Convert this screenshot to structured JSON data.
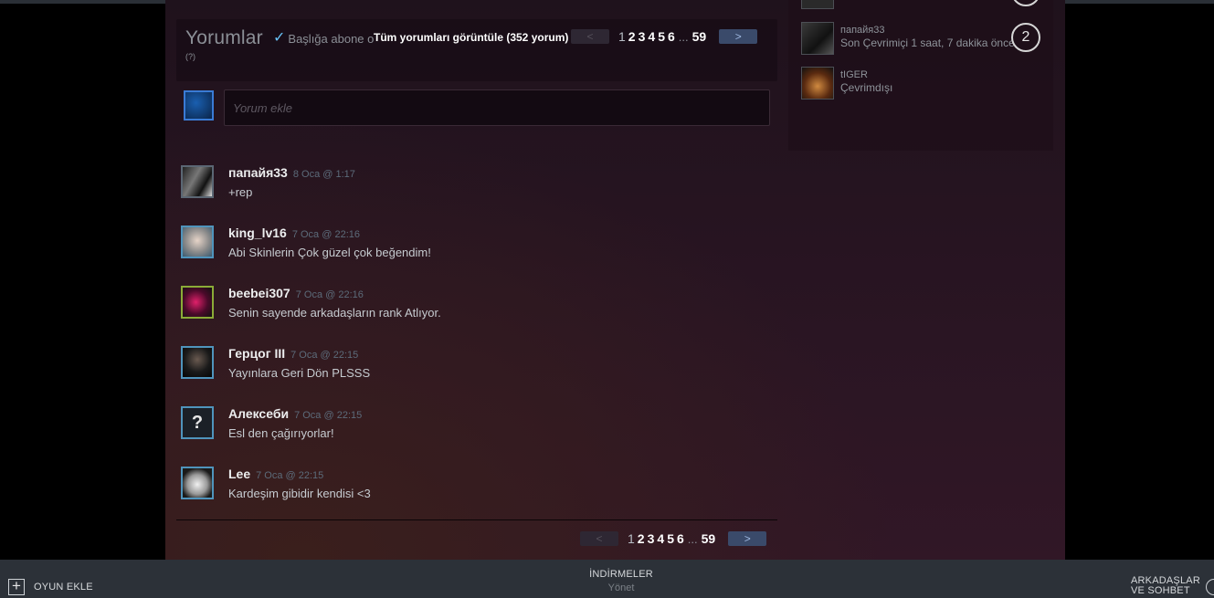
{
  "comments_section": {
    "title": "Yorumlar",
    "help": "(?)",
    "subscribe_label": "Başlığa abone ol",
    "view_all": "Tüm yorumları görüntüle (352 yorum)",
    "add_placeholder": "Yorum ekle",
    "pager": {
      "prev": "<",
      "next": ">",
      "pages": [
        "1",
        "2",
        "3",
        "4",
        "5",
        "6"
      ],
      "ellipsis": "...",
      "last": "59",
      "current": "1"
    },
    "comments": [
      {
        "author": "папайя33",
        "date": "8 Oca @ 1:17",
        "text": "+rep"
      },
      {
        "author": "king_lv16",
        "date": "7 Oca @ 22:16",
        "text": "Abi Skinlerin Çok güzel çok beğendim!"
      },
      {
        "author": "beebei307",
        "date": "7 Oca @ 22:16",
        "text": "Senin sayende arkadaşların rank Atlıyor."
      },
      {
        "author": "Герцог III",
        "date": "7 Oca @ 22:15",
        "text": "Yayınlara Geri Dön PLSSS"
      },
      {
        "author": "Алексеби",
        "date": "7 Oca @ 22:15",
        "text": "Esl den çağırıyorlar!"
      },
      {
        "author": "Lee",
        "date": "7 Oca @ 22:15",
        "text": "Kardeşim gibidir kendisi <3"
      }
    ]
  },
  "friends": [
    {
      "name": "папайя33",
      "status": "Son Çevrimiçi 1 saat, 7 dakika önce",
      "count": "2"
    },
    {
      "name": "tIGER",
      "status": "Çevrimdışı"
    }
  ],
  "bottom_bar": {
    "add_game": "OYUN EKLE",
    "downloads": "İNDİRMELER",
    "downloads_sub": "Yönet",
    "friends_chat_line1": "ARKADAŞLAR",
    "friends_chat_line2": "VE SOHBET"
  },
  "colors": {
    "accent": "#66c0f4",
    "next_button": "#3a4a6a",
    "bottom_bar": "#2c3138"
  }
}
